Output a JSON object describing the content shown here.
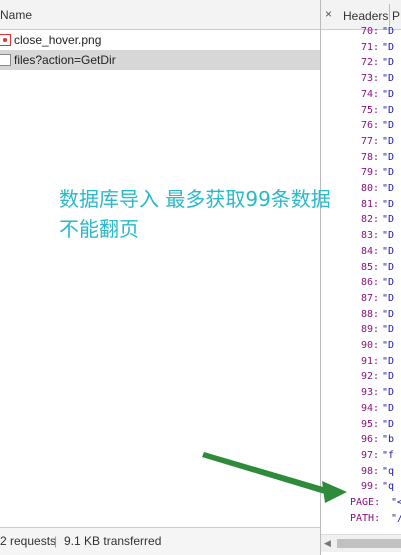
{
  "network": {
    "column_header": "Name",
    "requests": [
      {
        "name": "close_hover.png",
        "status": "error",
        "selected": false
      },
      {
        "name": "files?action=GetDir",
        "status": "ok",
        "selected": true
      }
    ],
    "status_bar": {
      "requests": "2 requests",
      "transferred": "9.1 KB transferred"
    }
  },
  "details": {
    "close_label": "×",
    "tab_headers": "Headers",
    "tab_next": "P",
    "json_lines": [
      {
        "key": "70:",
        "val": "\"D"
      },
      {
        "key": "71:",
        "val": "\"D"
      },
      {
        "key": "72:",
        "val": "\"D"
      },
      {
        "key": "73:",
        "val": "\"D"
      },
      {
        "key": "74:",
        "val": "\"D"
      },
      {
        "key": "75:",
        "val": "\"D"
      },
      {
        "key": "76:",
        "val": "\"D"
      },
      {
        "key": "77:",
        "val": "\"D"
      },
      {
        "key": "78:",
        "val": "\"D"
      },
      {
        "key": "79:",
        "val": "\"D"
      },
      {
        "key": "80:",
        "val": "\"D"
      },
      {
        "key": "81:",
        "val": "\"D"
      },
      {
        "key": "82:",
        "val": "\"D"
      },
      {
        "key": "83:",
        "val": "\"D"
      },
      {
        "key": "84:",
        "val": "\"D"
      },
      {
        "key": "85:",
        "val": "\"D"
      },
      {
        "key": "86:",
        "val": "\"D"
      },
      {
        "key": "87:",
        "val": "\"D"
      },
      {
        "key": "88:",
        "val": "\"D"
      },
      {
        "key": "89:",
        "val": "\"D"
      },
      {
        "key": "90:",
        "val": "\"D"
      },
      {
        "key": "91:",
        "val": "\"D"
      },
      {
        "key": "92:",
        "val": "\"D"
      },
      {
        "key": "93:",
        "val": "\"D"
      },
      {
        "key": "94:",
        "val": "\"D"
      },
      {
        "key": "95:",
        "val": "\"D"
      },
      {
        "key": "96:",
        "val": "\"b"
      },
      {
        "key": "97:",
        "val": "\"f"
      },
      {
        "key": "98:",
        "val": "\"q"
      },
      {
        "key": "99:",
        "val": "\"q"
      },
      {
        "key": "PAGE:",
        "val": "\"<"
      },
      {
        "key": "PATH:",
        "val": "\"/"
      }
    ]
  },
  "annotation": {
    "line1": "数据库导入  最多获取99条数据",
    "line2": "不能翻页",
    "color": "#2ab9c9",
    "arrow_color": "#2e8b3a"
  }
}
